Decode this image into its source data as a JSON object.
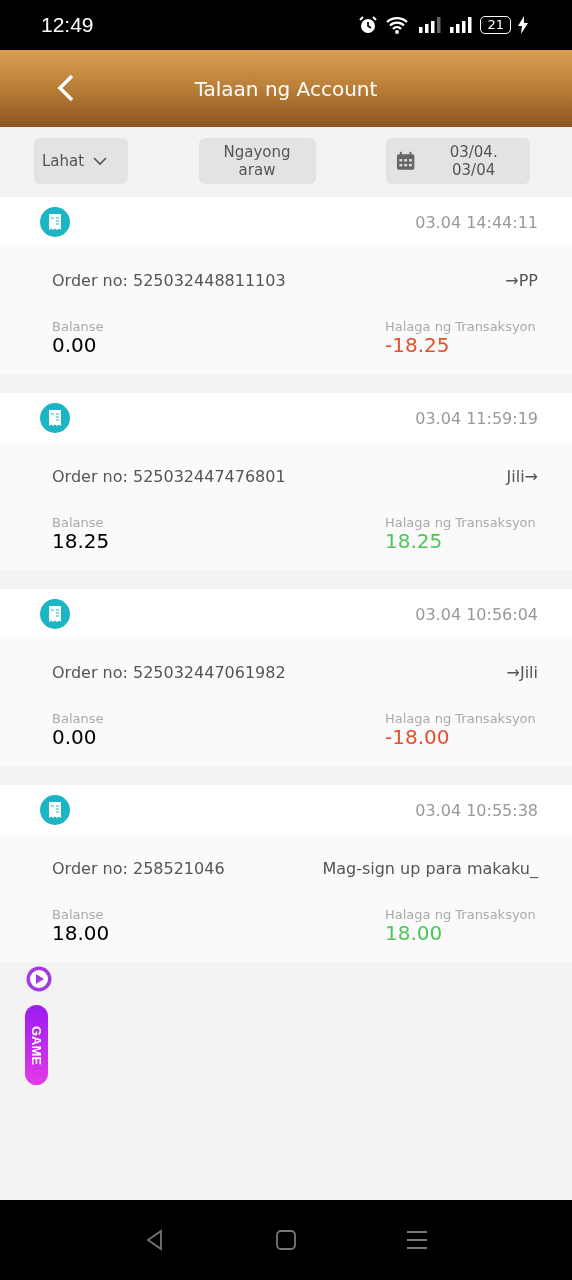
{
  "status_bar": {
    "time": "12:49",
    "battery": "21"
  },
  "header": {
    "title": "Talaan ng Account"
  },
  "filters": {
    "type": "Lahat",
    "period": "Ngayong araw",
    "date_range": "03/04. 03/04"
  },
  "records": [
    {
      "time": "03.04 14:44:11",
      "order": "Order no: 525032448811103",
      "target": "→PP",
      "balance_label": "Balanse",
      "balance": "0.00",
      "amount_label": "Halaga ng Transaksyon",
      "amount": "-18.25",
      "kind": "debit"
    },
    {
      "time": "03.04 11:59:19",
      "order": "Order no: 525032447476801",
      "target": "Jili→",
      "balance_label": "Balanse",
      "balance": "18.25",
      "amount_label": "Halaga ng Transaksyon",
      "amount": "18.25",
      "kind": "credit"
    },
    {
      "time": "03.04 10:56:04",
      "order": "Order no: 525032447061982",
      "target": "→Jili",
      "balance_label": "Balanse",
      "balance": "0.00",
      "amount_label": "Halaga ng Transaksyon",
      "amount": "-18.00",
      "kind": "debit"
    },
    {
      "time": "03.04 10:55:38",
      "order": "Order no: 258521046",
      "target": "Mag-sign up para makaku_",
      "balance_label": "Balanse",
      "balance": "18.00",
      "amount_label": "Halaga ng Transaksyon",
      "amount": "18.00",
      "kind": "credit"
    }
  ],
  "floating": {
    "game_label": "GAME"
  }
}
